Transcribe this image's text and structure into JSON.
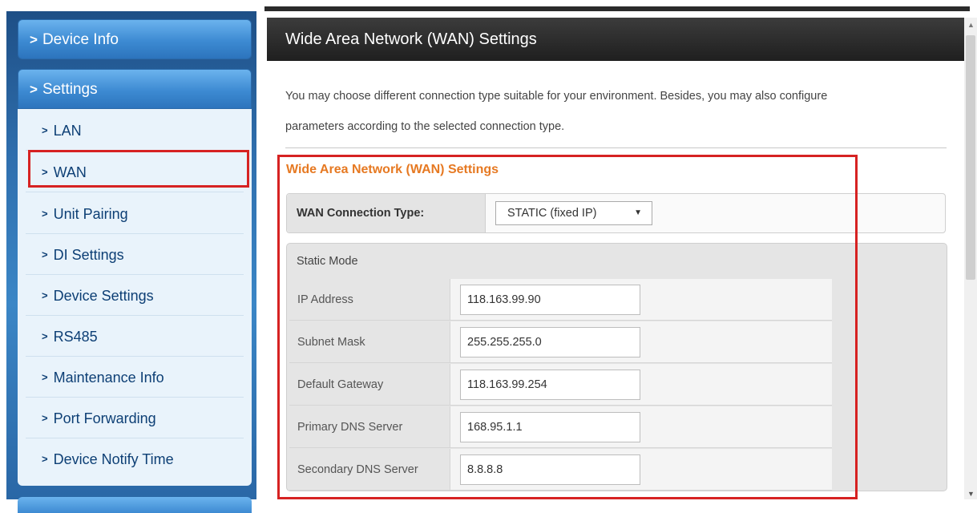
{
  "sidebar": {
    "heads": [
      {
        "label": "Device Info"
      },
      {
        "label": "Settings"
      }
    ],
    "items": [
      {
        "label": "LAN"
      },
      {
        "label": "WAN"
      },
      {
        "label": "Unit Pairing"
      },
      {
        "label": "DI Settings"
      },
      {
        "label": "Device Settings"
      },
      {
        "label": "RS485"
      },
      {
        "label": "Maintenance Info"
      },
      {
        "label": "Port Forwarding"
      },
      {
        "label": "Device Notify Time"
      }
    ],
    "chevron": ">"
  },
  "main": {
    "title": "Wide Area Network (WAN) Settings",
    "desc_line1": "You may choose different connection type suitable for your environment. Besides, you may also configure",
    "desc_line2": "parameters according to the selected connection type.",
    "section_title": "Wide Area Network (WAN) Settings",
    "connection_type_label": "WAN Connection Type:",
    "connection_type_value": "STATIC (fixed IP)",
    "static_title": "Static Mode",
    "fields": [
      {
        "label": "IP Address",
        "value": "118.163.99.90"
      },
      {
        "label": "Subnet Mask",
        "value": "255.255.255.0"
      },
      {
        "label": "Default Gateway",
        "value": "118.163.99.254"
      },
      {
        "label": "Primary DNS Server",
        "value": "168.95.1.1"
      },
      {
        "label": "Secondary DNS Server",
        "value": "8.8.8.8"
      }
    ]
  },
  "colors": {
    "accent_orange": "#e67922",
    "highlight_red": "#d62222",
    "sidebar_text": "#0d3f75"
  }
}
